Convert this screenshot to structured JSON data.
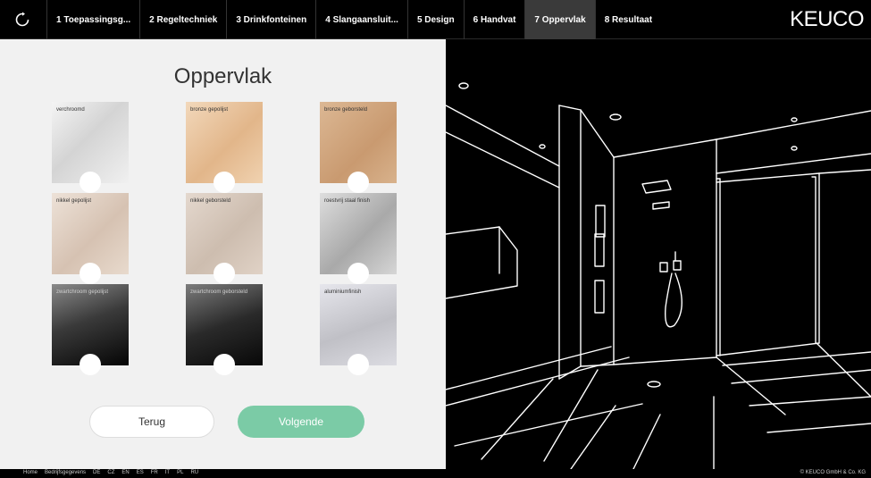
{
  "nav": {
    "tabs": [
      {
        "label": "1 Toepassingsg..."
      },
      {
        "label": "2 Regeltechniek"
      },
      {
        "label": "3 Drinkfonteinen"
      },
      {
        "label": "4 Slangaansluit..."
      },
      {
        "label": "5 Design"
      },
      {
        "label": "6 Handvat"
      },
      {
        "label": "7 Oppervlak"
      },
      {
        "label": "8 Resultaat"
      }
    ],
    "active_tab": "7 Oppervlak",
    "logo": "KEUCO"
  },
  "panel": {
    "title": "Oppervlak",
    "swatches": [
      {
        "label": "verchroomd"
      },
      {
        "label": "bronze gepolijst"
      },
      {
        "label": "bronze geborsteld"
      },
      {
        "label": "nikkel gepolijst"
      },
      {
        "label": "nikkel geborsteld"
      },
      {
        "label": "roestvrij staal finish"
      },
      {
        "label": "zwartchroom gepolijst"
      },
      {
        "label": "zwartchroom geborsteld"
      },
      {
        "label": "aluminiumfinish"
      }
    ],
    "back_label": "Terug",
    "next_label": "Volgende"
  },
  "footer": {
    "links": [
      "Home",
      "Bedrijfsgegevens",
      "DE",
      "CZ",
      "EN",
      "ES",
      "FR",
      "IT",
      "PL",
      "RU"
    ],
    "copyright": "© KEUCO GmbH & Co. KG"
  },
  "colors": {
    "accent": "#7bcba6",
    "panel_bg": "#f1f1f1",
    "nav_bg": "#000000"
  }
}
